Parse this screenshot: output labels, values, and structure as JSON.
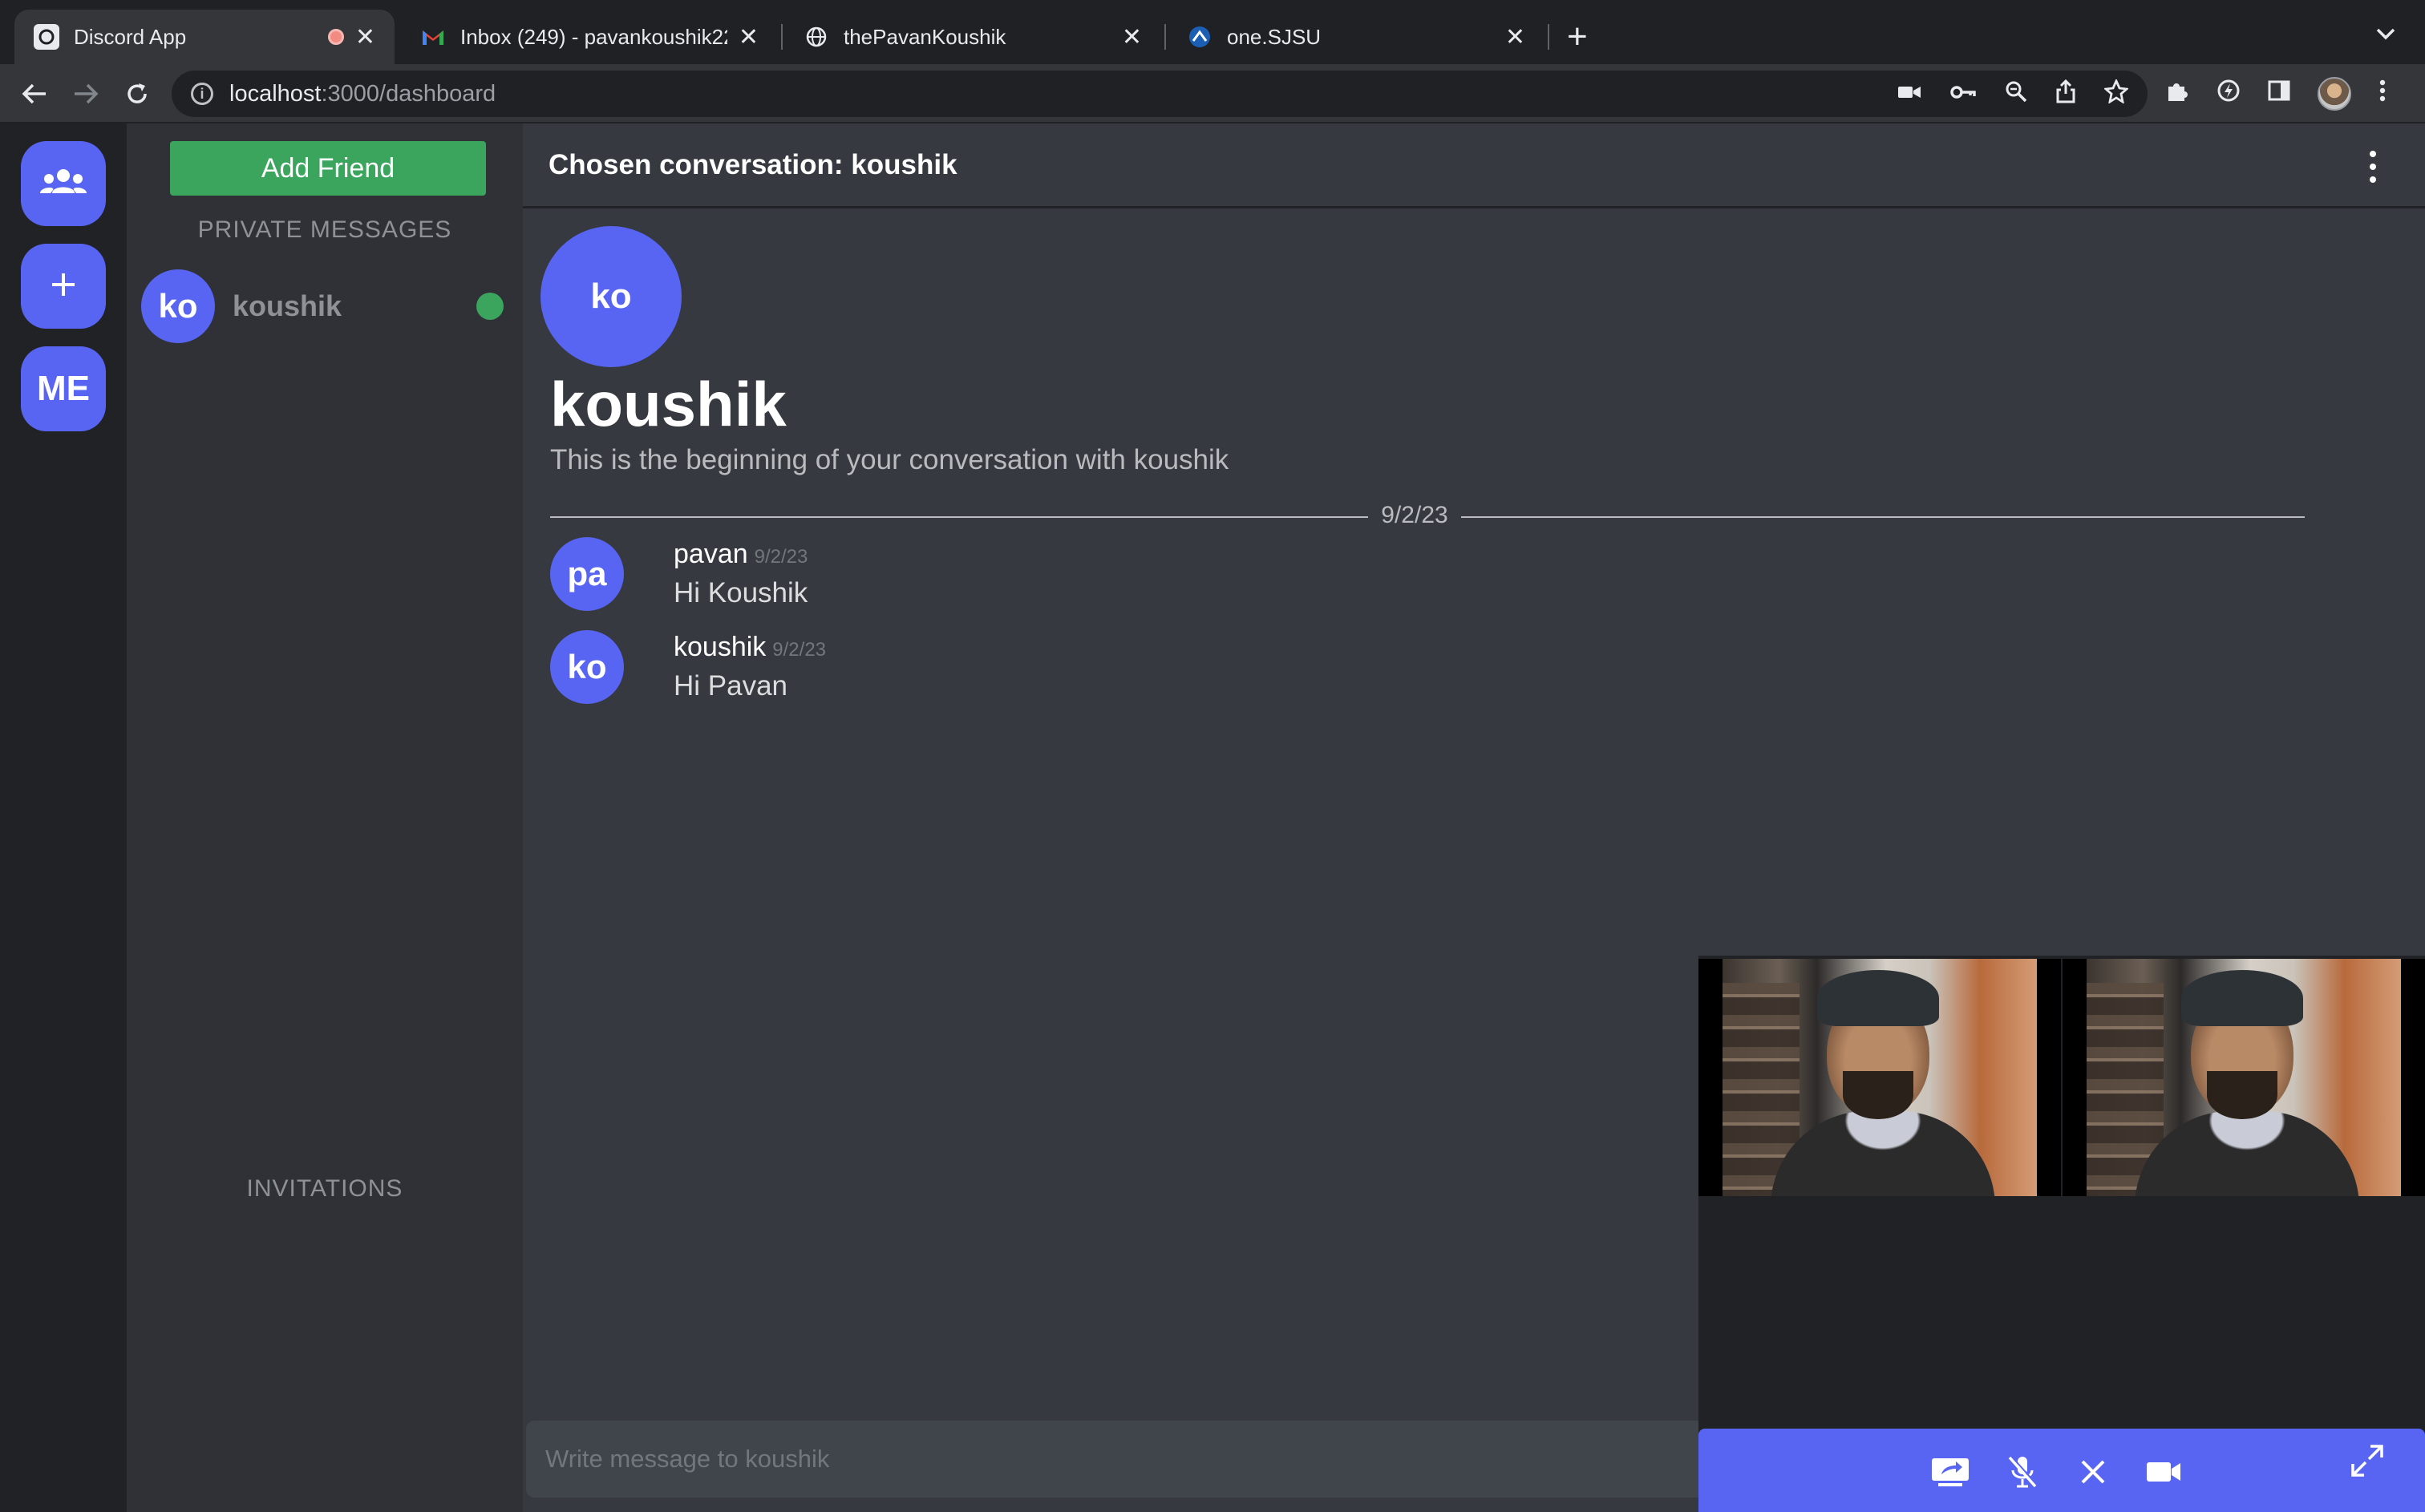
{
  "browser": {
    "tabs": [
      {
        "title": "Discord App",
        "active": true,
        "recording": true
      },
      {
        "title": "Inbox (249) - pavankoushik22…",
        "active": false
      },
      {
        "title": "thePavanKoushik",
        "active": false
      },
      {
        "title": "one.SJSU",
        "active": false
      }
    ],
    "url_host": "localhost",
    "url_path": ":3000/dashboard",
    "colors": {
      "chrome_bg": "#202124",
      "chrome_toolbar": "#35363a"
    }
  },
  "rail": {
    "friends_icon": "friends-icon",
    "add_icon": "plus-icon",
    "me_label": "ME"
  },
  "dm_panel": {
    "add_friend_label": "Add Friend",
    "private_messages_title": "PRIVATE MESSAGES",
    "friends": [
      {
        "initials": "ko",
        "name": "koushik",
        "online": true
      }
    ],
    "invitations_title": "INVITATIONS"
  },
  "chat": {
    "header_title": "Chosen conversation: koushik",
    "intro": {
      "initials": "ko",
      "name": "koushik",
      "description": "This is the beginning of your conversation with koushik"
    },
    "date_divider": "9/2/23",
    "messages": [
      {
        "initials": "pa",
        "author": "pavan",
        "time": "9/2/23",
        "text": "Hi Koushik"
      },
      {
        "initials": "ko",
        "author": "koushik",
        "time": "9/2/23",
        "text": "Hi Pavan"
      }
    ],
    "composer_placeholder": "Write message to koushik"
  },
  "call": {
    "video_tiles": 2,
    "buttons": [
      "screen-share-icon",
      "mic-off-icon",
      "close-icon",
      "camera-icon",
      "fullscreen-icon"
    ]
  },
  "colors": {
    "accent": "#5865f2",
    "success": "#3ba55d",
    "rail_bg": "#202225",
    "panel_bg": "#2f3136",
    "chat_bg": "#36393f"
  }
}
